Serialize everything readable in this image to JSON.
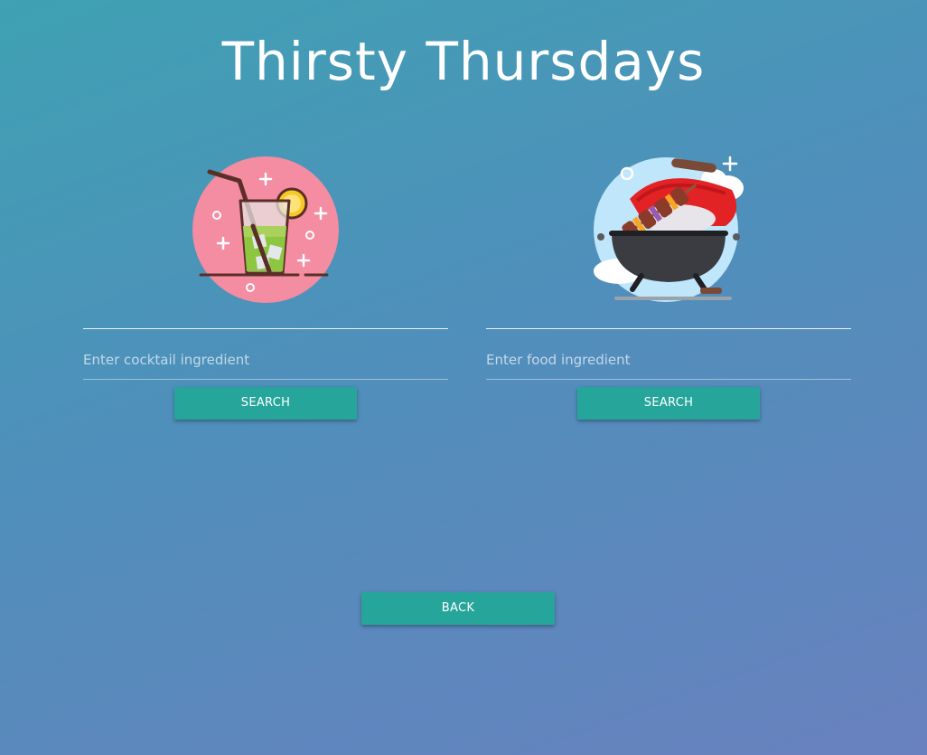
{
  "page": {
    "title": "Thirsty Thursdays"
  },
  "cocktail": {
    "icon": "cocktail-icon",
    "placeholder": "Enter cocktail ingredient",
    "value": "",
    "button_label": "SEARCH"
  },
  "food": {
    "icon": "grill-icon",
    "placeholder": "Enter food ingredient",
    "value": "",
    "button_label": "SEARCH"
  },
  "back": {
    "label": "BACK"
  },
  "colors": {
    "button": "#26a69a",
    "background_start": "#3fa1b3",
    "background_end": "#6981bf",
    "cocktail_circle": "#f48ca2",
    "grill_circle": "#bfe6fb"
  }
}
